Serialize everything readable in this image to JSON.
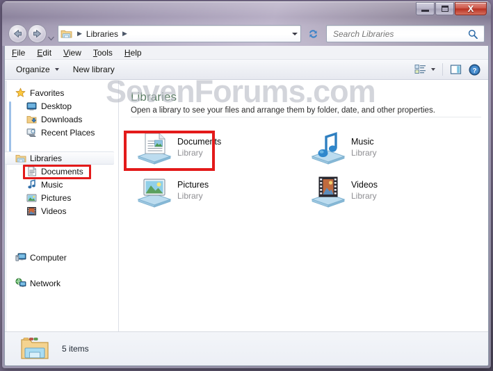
{
  "window": {
    "title": "Libraries",
    "caption_buttons": [
      {
        "name": "minimize",
        "glyph": "minimize-icon"
      },
      {
        "name": "maximize",
        "glyph": "maximize-icon"
      },
      {
        "name": "close",
        "glyph": "X"
      }
    ]
  },
  "nav": {
    "back_tooltip": "Back",
    "forward_tooltip": "Forward",
    "recent_pages": "Recent Pages",
    "refresh": "Refresh",
    "breadcrumb": [
      "Libraries"
    ],
    "breadcrumb_sep": "▶"
  },
  "search": {
    "placeholder": "Search Libraries",
    "value": ""
  },
  "menubar": {
    "items": [
      {
        "label": "File",
        "accel": "F"
      },
      {
        "label": "Edit",
        "accel": "E"
      },
      {
        "label": "View",
        "accel": "V"
      },
      {
        "label": "Tools",
        "accel": "T"
      },
      {
        "label": "Help",
        "accel": "H"
      }
    ]
  },
  "toolbar": {
    "organize_label": "Organize",
    "new_library_label": "New library",
    "change_view_icon": "change-view-icon",
    "preview_pane_icon": "preview-pane-icon",
    "help_icon": "help-icon"
  },
  "watermark": {
    "text": "SevenForums.com"
  },
  "sidebar": {
    "groups": [
      {
        "header": {
          "label": "Favorites",
          "icon": "star-icon"
        },
        "items": [
          {
            "label": "Desktop",
            "icon": "desktop-icon"
          },
          {
            "label": "Downloads",
            "icon": "downloads-icon"
          },
          {
            "label": "Recent Places",
            "icon": "recent-places-icon"
          }
        ]
      },
      {
        "header": {
          "label": "Libraries",
          "icon": "libraries-icon",
          "selected": true
        },
        "items": [
          {
            "label": "Documents",
            "icon": "documents-icon",
            "highlighted": true
          },
          {
            "label": "Music",
            "icon": "music-icon"
          },
          {
            "label": "Pictures",
            "icon": "pictures-icon"
          },
          {
            "label": "Videos",
            "icon": "videos-icon"
          }
        ]
      },
      {
        "header": {
          "label": "Computer",
          "icon": "computer-icon"
        },
        "items": []
      },
      {
        "header": {
          "label": "Network",
          "icon": "network-icon"
        },
        "items": []
      }
    ]
  },
  "content": {
    "title": "Libraries",
    "subtitle": "Open a library to see your files and arrange them by folder, date, and other properties.",
    "kind_label": "Library",
    "items": [
      {
        "name": "Documents",
        "kind": "Library",
        "icon": "documents-library-icon",
        "highlighted": true
      },
      {
        "name": "Music",
        "kind": "Library",
        "icon": "music-library-icon"
      },
      {
        "name": "Pictures",
        "kind": "Library",
        "icon": "pictures-library-icon"
      },
      {
        "name": "Videos",
        "kind": "Library",
        "icon": "videos-library-icon"
      }
    ]
  },
  "statusbar": {
    "icon": "libraries-folder-icon",
    "text": "5 items"
  },
  "colors": {
    "highlight_box": "#e31a1a",
    "heading": "#5a7b63",
    "close_button": "#b83122"
  }
}
